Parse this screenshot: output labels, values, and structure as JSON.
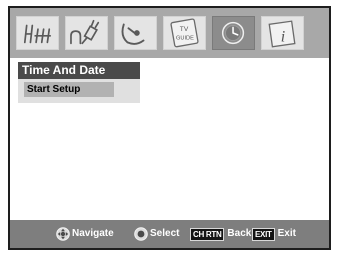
{
  "icon_bar": {
    "tiles": [
      {
        "icon": "antenna-icon"
      },
      {
        "icon": "plug-icon"
      },
      {
        "icon": "satellite-dish-icon"
      },
      {
        "icon": "tv-guide-icon",
        "label_line1": "TV",
        "label_line2": "GUIDE"
      },
      {
        "icon": "clock-icon",
        "selected": true
      },
      {
        "icon": "info-icon",
        "glyph": "i"
      }
    ]
  },
  "menu": {
    "title": "Time And Date",
    "items": [
      {
        "label": "Start Setup",
        "highlighted": true
      }
    ]
  },
  "help_bar": {
    "navigate": {
      "icon": "navigate-dial-icon",
      "label": "Navigate"
    },
    "select": {
      "icon": "select-dial-icon",
      "label": "Select"
    },
    "back": {
      "key": "CH RTN",
      "label": "Back"
    },
    "exit": {
      "key": "EXIT",
      "label": "Exit"
    }
  },
  "colors": {
    "icon_bar_bg": "#a8a8a8",
    "tile_bg": "#e4e4e4",
    "tile_selected_bg": "#8c8c8c",
    "icon_stroke": "#5a5a5a",
    "menu_title_bg": "#4a4a4a",
    "menu_panel_bg": "#e0e0e0",
    "item_highlight_bg": "#b2b2b2",
    "help_bar_bg": "#7e7e7e",
    "keycap_bg": "#141414"
  }
}
